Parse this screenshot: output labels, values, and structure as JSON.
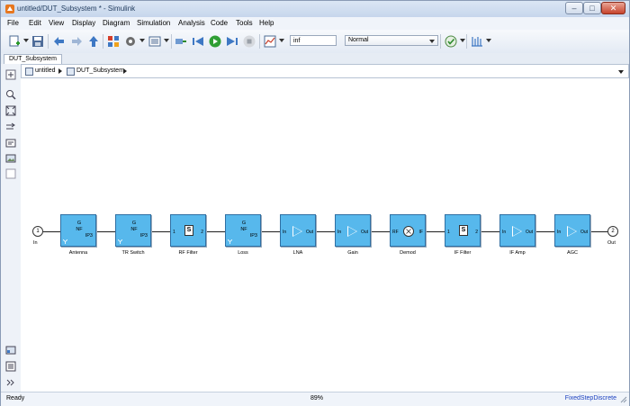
{
  "window": {
    "title": "untitled/DUT_Subsystem * - Simulink",
    "controls": {
      "minimize": "–",
      "maximize": "□",
      "close": "✕"
    }
  },
  "menu": [
    "File",
    "Edit",
    "View",
    "Display",
    "Diagram",
    "Simulation",
    "Analysis",
    "Code",
    "Tools",
    "Help"
  ],
  "toolbar": {
    "stop_time": "inf",
    "sim_mode": "Normal"
  },
  "tab": {
    "label": "DUT_Subsystem"
  },
  "breadcrumb": [
    "untitled",
    "DUT_Subsystem"
  ],
  "ports": {
    "in": {
      "number": "1",
      "label": "In"
    },
    "out": {
      "number": "2",
      "label": "Out"
    }
  },
  "blocks": [
    {
      "label": "Antenna",
      "kind": "gnf",
      "g": "G",
      "nf": "NF",
      "ip3": "IP3"
    },
    {
      "label": "TR Switch",
      "kind": "gnf",
      "g": "G",
      "nf": "NF",
      "ip3": "IP3"
    },
    {
      "label": "RF Filter",
      "kind": "filter",
      "s": "S",
      "p1": "1",
      "p2": "2"
    },
    {
      "label": "Loss",
      "kind": "gnf",
      "g": "G",
      "nf": "NF",
      "ip3": "IP3"
    },
    {
      "label": "LNA",
      "kind": "amp",
      "pin": "In",
      "pout": "Out"
    },
    {
      "label": "Gain",
      "kind": "amp",
      "pin": "In",
      "pout": "Out"
    },
    {
      "label": "Demod",
      "kind": "mixer",
      "pin": "RF",
      "pout": "IF"
    },
    {
      "label": "IF Filter",
      "kind": "filter",
      "s": "S",
      "p1": "1",
      "p2": "2"
    },
    {
      "label": "IF Amp",
      "kind": "amp",
      "pin": "In",
      "pout": "Out"
    },
    {
      "label": "AGC",
      "kind": "amp",
      "pin": "In",
      "pout": "Out"
    }
  ],
  "status": {
    "state": "Ready",
    "zoom": "89%",
    "solver": "FixedStepDiscrete"
  },
  "icons": [
    "simulink-app-icon",
    "new-model-icon",
    "save-icon",
    "back-icon",
    "forward-icon",
    "up-icon",
    "library-browser-icon",
    "model-config-icon",
    "explorer-icon",
    "step-back-icon",
    "run-icon",
    "step-forward-icon",
    "stop-icon",
    "scope-icon",
    "check-icon",
    "grid-icon"
  ]
}
